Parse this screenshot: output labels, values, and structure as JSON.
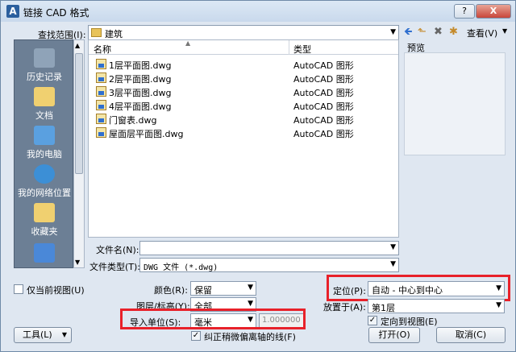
{
  "window": {
    "title": "链接 CAD 格式",
    "help_label": "?",
    "close_label": "X"
  },
  "lookin": {
    "label": "查找范围(I):",
    "value": "建筑"
  },
  "toolbar": {
    "view_label": "查看(V)"
  },
  "places": [
    {
      "label": "历史记录",
      "color": "#8fa3b8"
    },
    {
      "label": "文档",
      "color": "#f0d070"
    },
    {
      "label": "我的电脑",
      "color": "#5aa0e0"
    },
    {
      "label": "我的网络位置",
      "color": "#3c8fd6"
    },
    {
      "label": "收藏夹",
      "color": "#f0d070"
    },
    {
      "label": "",
      "color": "#4a88d8"
    }
  ],
  "list": {
    "col_name": "名称",
    "col_type": "类型",
    "files": [
      {
        "name": "1层平面图.dwg",
        "type": "AutoCAD 图形"
      },
      {
        "name": "2层平面图.dwg",
        "type": "AutoCAD 图形"
      },
      {
        "name": "3层平面图.dwg",
        "type": "AutoCAD 图形"
      },
      {
        "name": "4层平面图.dwg",
        "type": "AutoCAD 图形"
      },
      {
        "name": "门窗表.dwg",
        "type": "AutoCAD 图形"
      },
      {
        "name": "屋面层平面图.dwg",
        "type": "AutoCAD 图形"
      }
    ]
  },
  "preview": {
    "label": "预览"
  },
  "filename": {
    "label": "文件名(N):",
    "value": ""
  },
  "filetype": {
    "label": "文件类型(T):",
    "value": "DWG 文件 (*.dwg)"
  },
  "options": {
    "current_view_label": "仅当前视图(U)",
    "color_label": "颜色(R):",
    "color_value": "保留",
    "layers_label": "图层/标高(Y):",
    "layers_value": "全部",
    "units_label": "导入单位(S):",
    "units_value": "毫米",
    "units_scale": "1.000000",
    "correct_lines_label": "纠正稍微偏离轴的线(F)",
    "positioning_label": "定位(P):",
    "positioning_value": "自动 - 中心到中心",
    "place_at_label": "放置于(A):",
    "place_at_value": "第1层",
    "orient_label": "定向到视图(E)"
  },
  "buttons": {
    "tools": "工具(L)",
    "open": "打开(O)",
    "cancel": "取消(C)"
  },
  "colors": {
    "highlight": "#e8212a"
  }
}
